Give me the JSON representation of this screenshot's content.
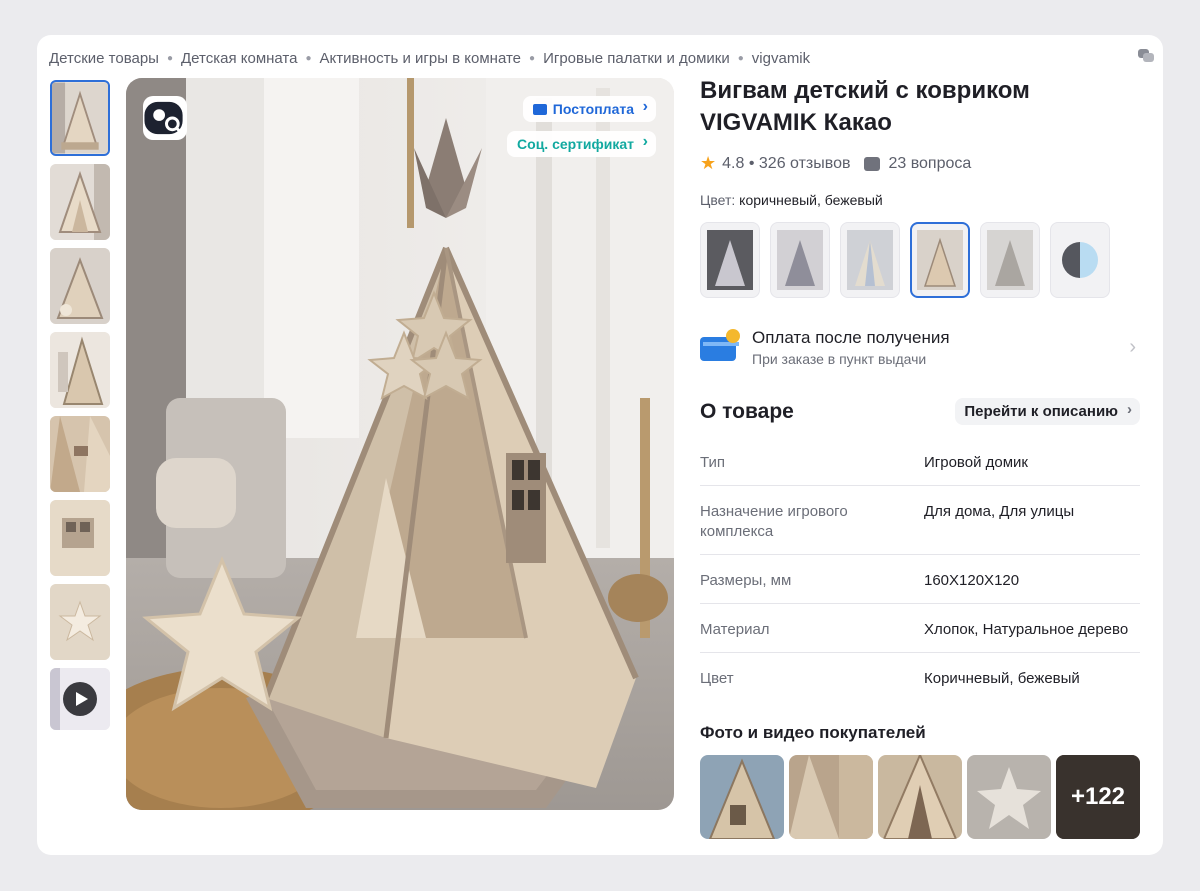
{
  "breadcrumbs": [
    "Детские товары",
    "Детская комната",
    "Активность и игры в комнате",
    "Игровые палатки и домики",
    "vigvamik"
  ],
  "gallery": {
    "thumb_count": 7,
    "badges": {
      "postpay": "Постоплата",
      "certificate": "Соц. сертификат"
    }
  },
  "product": {
    "title": "Вигвам детский с ковриком VIGVAMIK Какао",
    "rating": "4.8",
    "reviews": "326 отзывов",
    "questions": "23 вопроса",
    "color_label": "Цвет:",
    "color_value": "коричневый, бежевый"
  },
  "payment": {
    "title": "Оплата после получения",
    "subtitle": "При заказе в пункт выдачи"
  },
  "about": {
    "title": "О товаре",
    "goto_label": "Перейти к описанию",
    "specs": [
      {
        "key": "Тип",
        "value": "Игровой домик"
      },
      {
        "key": "Назначение игрового комплекса",
        "value": "Для дома, Для улицы"
      },
      {
        "key": "Размеры, мм",
        "value": "160X120X120"
      },
      {
        "key": "Материал",
        "value": "Хлопок, Натуральное дерево"
      },
      {
        "key": "Цвет",
        "value": "Коричневый, бежевый"
      }
    ]
  },
  "buyer_photos": {
    "title": "Фото и видео покупателей",
    "more_count": "+122"
  },
  "colors": {
    "accent": "#2e6fd8",
    "star": "#f7a21b",
    "cert": "#12a9a0",
    "tent": "#d9c9b3",
    "trim": "#a08d7d"
  }
}
